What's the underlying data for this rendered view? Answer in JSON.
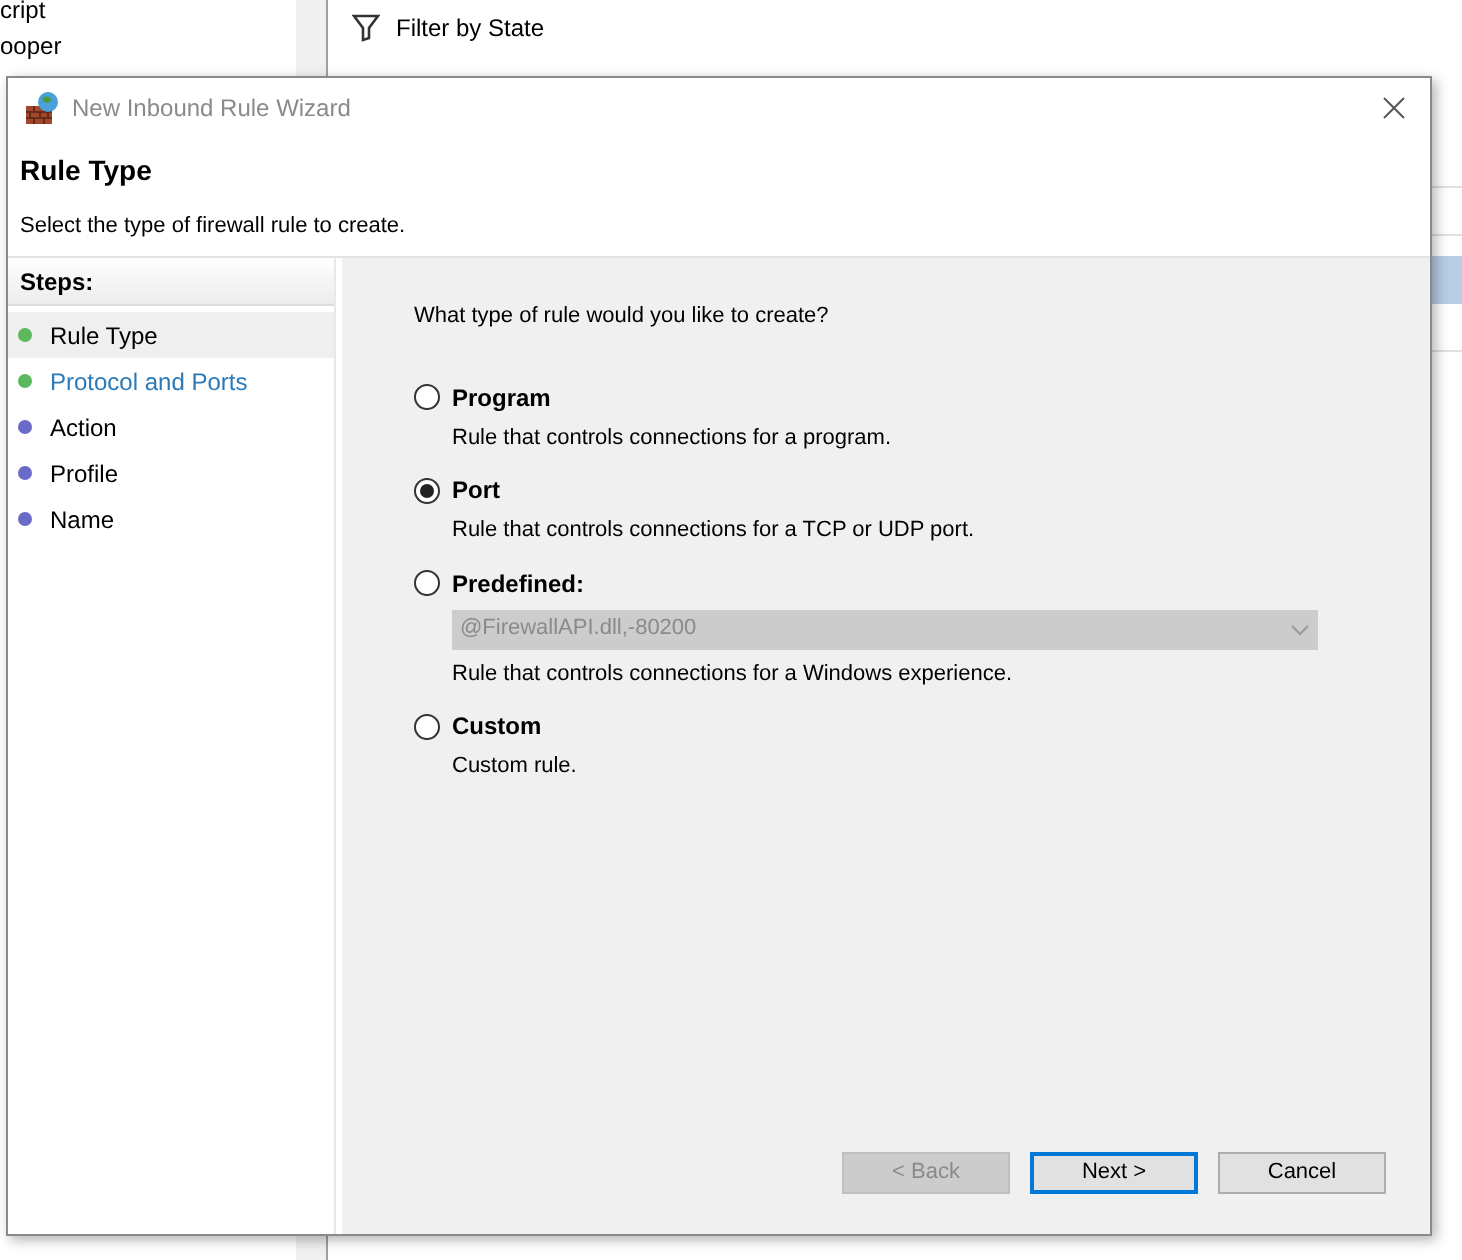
{
  "background": {
    "left_items": [
      "cript",
      "ooper"
    ],
    "right_items": [
      "Filter by State"
    ]
  },
  "window": {
    "title": "New Inbound Rule Wizard"
  },
  "header": {
    "title": "Rule Type",
    "subtitle": "Select the type of firewall rule to create."
  },
  "steps": {
    "title": "Steps:",
    "items": [
      {
        "label": "Rule Type",
        "selected": true,
        "kind": "plain",
        "color": "#5cb85c"
      },
      {
        "label": "Protocol and Ports",
        "selected": false,
        "kind": "link",
        "color": "#5cb85c"
      },
      {
        "label": "Action",
        "selected": false,
        "kind": "plain",
        "color": "#6a6ac8"
      },
      {
        "label": "Profile",
        "selected": false,
        "kind": "plain",
        "color": "#6a6ac8"
      },
      {
        "label": "Name",
        "selected": false,
        "kind": "plain",
        "color": "#6a6ac8"
      }
    ]
  },
  "question": "What type of rule would you like to create?",
  "options": [
    {
      "label": "Program",
      "description": "Rule that controls connections for a program.",
      "selected": false
    },
    {
      "label": "Port",
      "description": "Rule that controls connections for a TCP or UDP port.",
      "selected": true
    },
    {
      "label": "Predefined:",
      "description": "Rule that controls connections for a Windows experience.",
      "selected": false,
      "dropdown": {
        "value": "@FirewallAPI.dll,-80200",
        "disabled": true
      }
    },
    {
      "label": "Custom",
      "description": "Custom rule.",
      "selected": false
    }
  ],
  "buttons": [
    {
      "label": "< Back",
      "disabled": true,
      "default": false
    },
    {
      "label": "Next >",
      "disabled": false,
      "default": true
    },
    {
      "label": "Cancel",
      "disabled": false,
      "default": false
    }
  ]
}
